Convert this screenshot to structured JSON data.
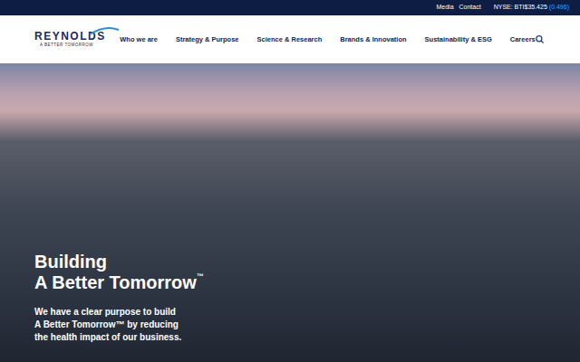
{
  "topbar": {
    "links": [
      "Media",
      "Contact"
    ],
    "ticker": {
      "label": "NYSE: BTI$35.425",
      "change": "(0.496)"
    }
  },
  "logo": {
    "name": "REYNOLDS",
    "tagline": "A BETTER TOMORROW"
  },
  "nav": {
    "items": [
      "Who we are",
      "Strategy & Purpose",
      "Science & Research",
      "Brands & Innovation",
      "Sustainability & ESG",
      "Careers"
    ]
  },
  "hero": {
    "heading": [
      "Building",
      "A Better Tomorrow"
    ],
    "trademark": "™",
    "body": [
      "We have a clear purpose to build",
      "A Better Tomorrow™ by reducing",
      "the health impact of our business."
    ]
  }
}
